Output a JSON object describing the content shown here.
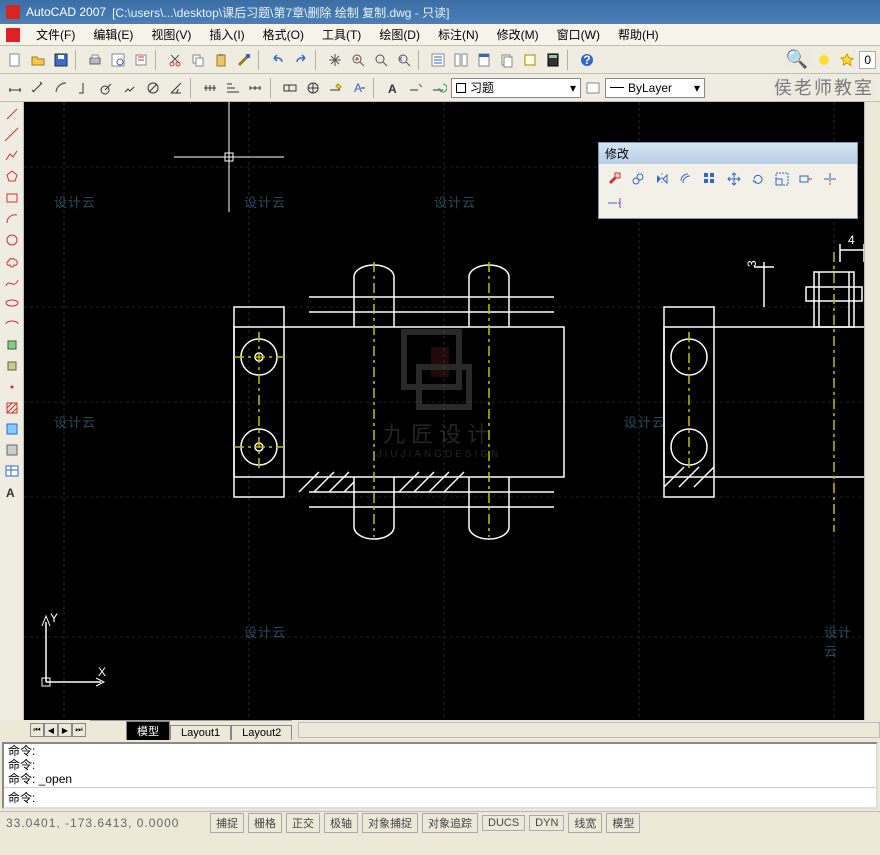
{
  "title_app": "AutoCAD 2007",
  "title_doc": "[C:\\users\\...\\desktop\\课后习题\\第7章\\删除  绘制  复制.dwg  - 只读]",
  "menu": [
    {
      "label": "文件(F)"
    },
    {
      "label": "编辑(E)"
    },
    {
      "label": "视图(V)"
    },
    {
      "label": "插入(I)"
    },
    {
      "label": "格式(O)"
    },
    {
      "label": "工具(T)"
    },
    {
      "label": "绘图(D)"
    },
    {
      "label": "标注(N)"
    },
    {
      "label": "修改(M)"
    },
    {
      "label": "窗口(W)"
    },
    {
      "label": "帮助(H)"
    }
  ],
  "layer_combo": "习题",
  "line_combo": "ByLayer",
  "overlay_right": "侯老师教室",
  "overlay_right_count": "0",
  "float_title": "修改",
  "tabs": {
    "model": "模型",
    "l1": "Layout1",
    "l2": "Layout2"
  },
  "cmd": {
    "line1": "命令:",
    "line2": "命令:",
    "line3": "命令: _open",
    "prompt": "命令:"
  },
  "status": {
    "coords": "33.0401, -173.6413,  0.0000",
    "toggles": [
      "捕捉",
      "栅格",
      "正交",
      "极轴",
      "对象捕捉",
      "对象追踪",
      "DUCS",
      "DYN",
      "线宽",
      "模型"
    ]
  },
  "watermarks": [
    "设计云",
    "设计云",
    "设计云",
    "设计云",
    "设计云",
    "设计云",
    "设计云",
    "设计云"
  ],
  "center_mark": {
    "line1": "九匠设计",
    "line2": "JIUJIANGDESIGN"
  },
  "dims": {
    "d1": "3",
    "d2": "4"
  }
}
